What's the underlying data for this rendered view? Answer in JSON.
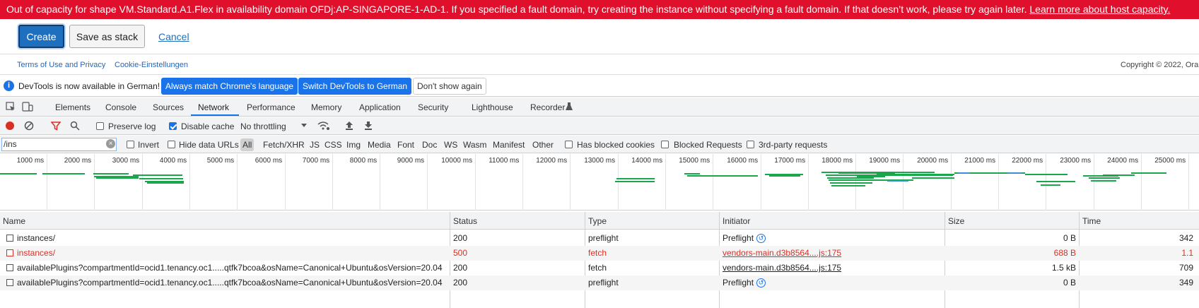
{
  "banner": {
    "message": "Out of capacity for shape VM.Standard.A1.Flex in availability domain OFDj:AP-SINGAPORE-1-AD-1. If you specified a fault domain, try creating the instance without specifying a fault domain. If that doesn’t work, please try again later.",
    "link": "Learn more about host capacity."
  },
  "actions": {
    "create": "Create",
    "save_stack": "Save as stack",
    "cancel": "Cancel"
  },
  "footer": {
    "terms": "Terms of Use and Privacy",
    "cookies": "Cookie-Einstellungen",
    "copyright": "Copyright © 2022, Ora"
  },
  "infobar": {
    "message": "DevTools is now available in German!",
    "btn_match": "Always match Chrome's language",
    "btn_switch": "Switch DevTools to German",
    "btn_dismiss": "Don't show again"
  },
  "devtools_tabs": [
    "Elements",
    "Console",
    "Sources",
    "Network",
    "Performance",
    "Memory",
    "Application",
    "Security",
    "Lighthouse",
    "Recorder"
  ],
  "active_tab": "Network",
  "toolbar": {
    "preserve_log": "Preserve log",
    "disable_cache": "Disable cache",
    "throttling": "No throttling"
  },
  "filter": {
    "value": "/ins",
    "invert": "Invert",
    "hide_data_urls": "Hide data URLs",
    "types": [
      "All",
      "Fetch/XHR",
      "JS",
      "CSS",
      "Img",
      "Media",
      "Font",
      "Doc",
      "WS",
      "Wasm",
      "Manifest",
      "Other"
    ],
    "has_blocked_cookies": "Has blocked cookies",
    "blocked_requests": "Blocked Requests",
    "third_party": "3rd-party requests"
  },
  "timeline_ticks": [
    "1000 ms",
    "2000 ms",
    "3000 ms",
    "4000 ms",
    "5000 ms",
    "6000 ms",
    "7000 ms",
    "8000 ms",
    "9000 ms",
    "10000 ms",
    "11000 ms",
    "12000 ms",
    "13000 ms",
    "14000 ms",
    "15000 ms",
    "16000 ms",
    "17000 ms",
    "18000 ms",
    "19000 ms",
    "20000 ms",
    "21000 ms",
    "22000 ms",
    "23000 ms",
    "24000 ms",
    "25000 ms"
  ],
  "columns": {
    "name": "Name",
    "status": "Status",
    "type": "Type",
    "initiator": "Initiator",
    "size": "Size",
    "time": "Time"
  },
  "rows": [
    {
      "name": "instances/",
      "status": "200",
      "type": "preflight",
      "initiator": "Preflight",
      "size": "0 B",
      "time": "342"
    },
    {
      "name": "instances/",
      "status": "500",
      "type": "fetch",
      "initiator": "vendors-main.d3b8564....js:175",
      "size": "688 B",
      "time": "1.1"
    },
    {
      "name": "availablePlugins?compartmentId=ocid1.tenancy.oc1.....qtfk7bcoa&osName=Canonical+Ubuntu&osVersion=20.04",
      "status": "200",
      "type": "fetch",
      "initiator": "vendors-main.d3b8564....js:175",
      "size": "1.5 kB",
      "time": "709"
    },
    {
      "name": "availablePlugins?compartmentId=ocid1.tenancy.oc1.....qtfk7bcoa&osName=Canonical+Ubuntu&osVersion=20.04",
      "status": "200",
      "type": "preflight",
      "initiator": "Preflight",
      "size": "0 B",
      "time": "349"
    }
  ],
  "colors": {
    "error_banner": "#e0102c",
    "accent": "#1a73e8",
    "error_text": "#d93025",
    "bar_green": "#1aa64a"
  }
}
